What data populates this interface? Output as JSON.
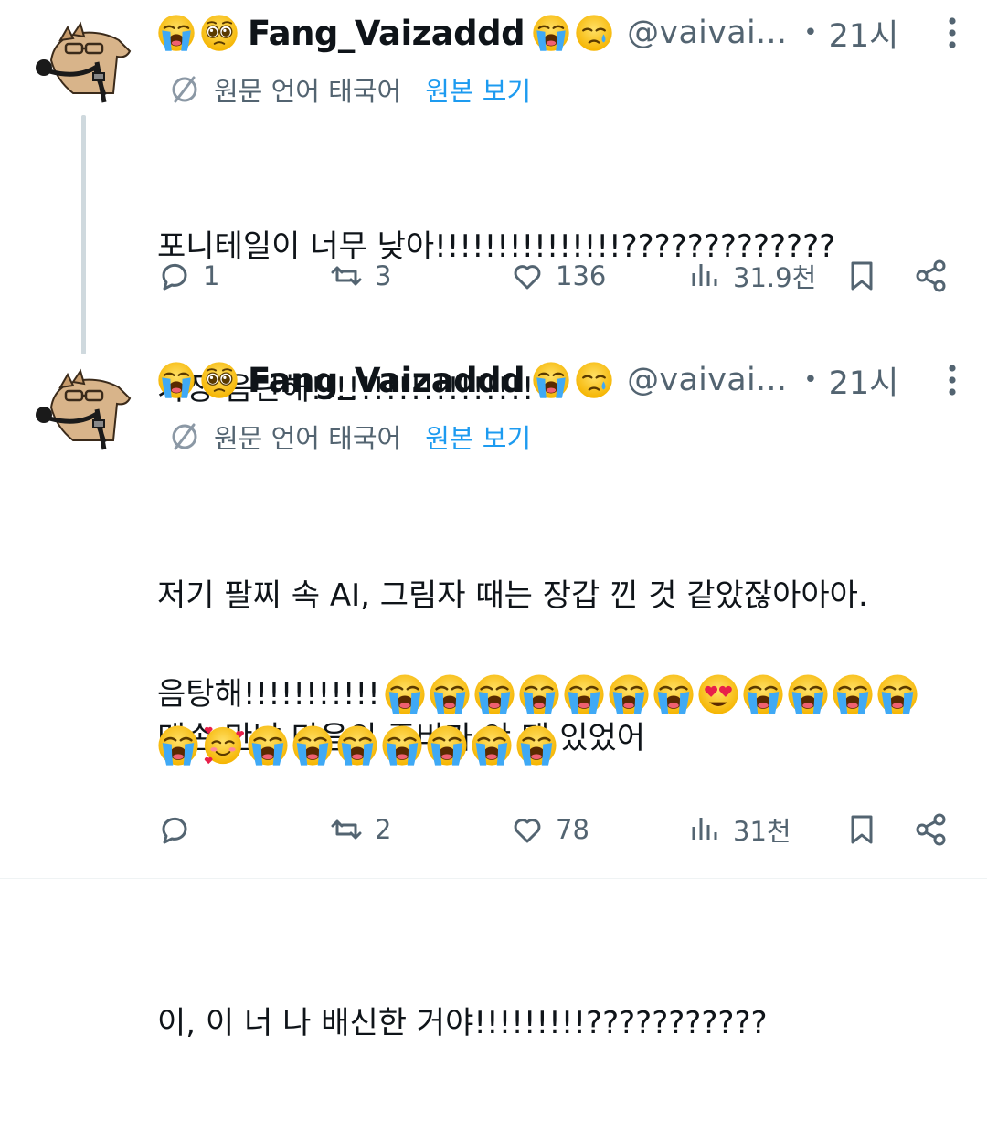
{
  "tweets": [
    {
      "author": {
        "name": "Fang_Vaizaddd",
        "handle": "@vaivai...",
        "time": "21시",
        "dot": "•"
      },
      "translation": {
        "label": "원문 언어 태국어",
        "link": "원본 보기"
      },
      "text_lines": [
        "포니테일이 너무 낮아!!!!!!!!!!!!!!!?????????????",
        "가장 음란해!!!!!!!!!!!!!!!!!!"
      ],
      "stats": {
        "replies": "1",
        "reposts": "3",
        "likes": "136",
        "views": "31.9천"
      }
    },
    {
      "author": {
        "name": "Fang_Vaizaddd",
        "handle": "@vaivai...",
        "time": "21시",
        "dot": "•"
      },
      "translation": {
        "label": "원문 언어 태국어",
        "link": "원본 보기"
      },
      "text_lines": [
        "저기 팔찌 속 AI, 그림자 때는 장갑 낀 것 같았잖아아아.",
        "맨손 만날 마음의 준비가 안 돼 있었어",
        "",
        "이, 이 너 나 배신한 거야!!!!!!!!!???????????",
        "음탕해!!!!!!!!!!!"
      ],
      "stats": {
        "replies": "",
        "reposts": "2",
        "likes": "78",
        "views": "31천"
      }
    }
  ],
  "emoji_names": {
    "name_prefix": [
      "loudly-crying-face",
      "pleading-face"
    ],
    "name_suffix": [
      "loudly-crying-face",
      "crying-face"
    ],
    "line4_trail": [
      "loudly-crying-face",
      "loudly-crying-face",
      "loudly-crying-face",
      "loudly-crying-face",
      "loudly-crying-face",
      "loudly-crying-face",
      "loudly-crying-face",
      "heart-eyes-face",
      "loudly-crying-face",
      "loudly-crying-face",
      "loudly-crying-face",
      "loudly-crying-face"
    ],
    "line5": [
      "loudly-crying-face",
      "smiling-face-with-hearts",
      "loudly-crying-face",
      "loudly-crying-face",
      "loudly-crying-face",
      "loudly-crying-face",
      "loudly-crying-face",
      "loudly-crying-face",
      "loudly-crying-face"
    ]
  },
  "colors": {
    "text": "#0f1419",
    "secondary": "#536471",
    "link": "#1d9bf0",
    "thread_line": "#cfd9de"
  }
}
